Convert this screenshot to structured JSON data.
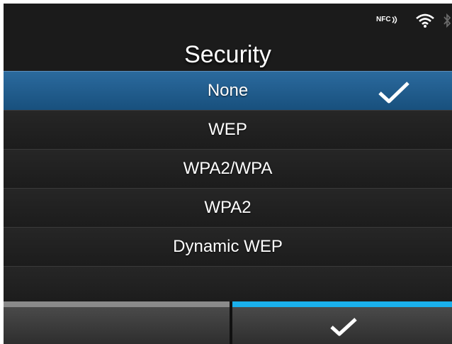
{
  "status": {
    "nfc_label": "NFC",
    "icons": [
      "nfc-icon",
      "wifi-icon",
      "bluetooth-icon"
    ]
  },
  "title": "Security",
  "options": [
    {
      "label": "None",
      "selected": true
    },
    {
      "label": "WEP",
      "selected": false
    },
    {
      "label": "WPA2/WPA",
      "selected": false
    },
    {
      "label": "WPA2",
      "selected": false
    },
    {
      "label": "Dynamic WEP",
      "selected": false
    }
  ],
  "softkeys": {
    "left": {
      "icon": null
    },
    "right": {
      "icon": "checkmark-icon"
    }
  },
  "colors": {
    "selected_row": "#1f5c8f",
    "accent": "#1ab0ec",
    "background": "#1b1b1b"
  }
}
